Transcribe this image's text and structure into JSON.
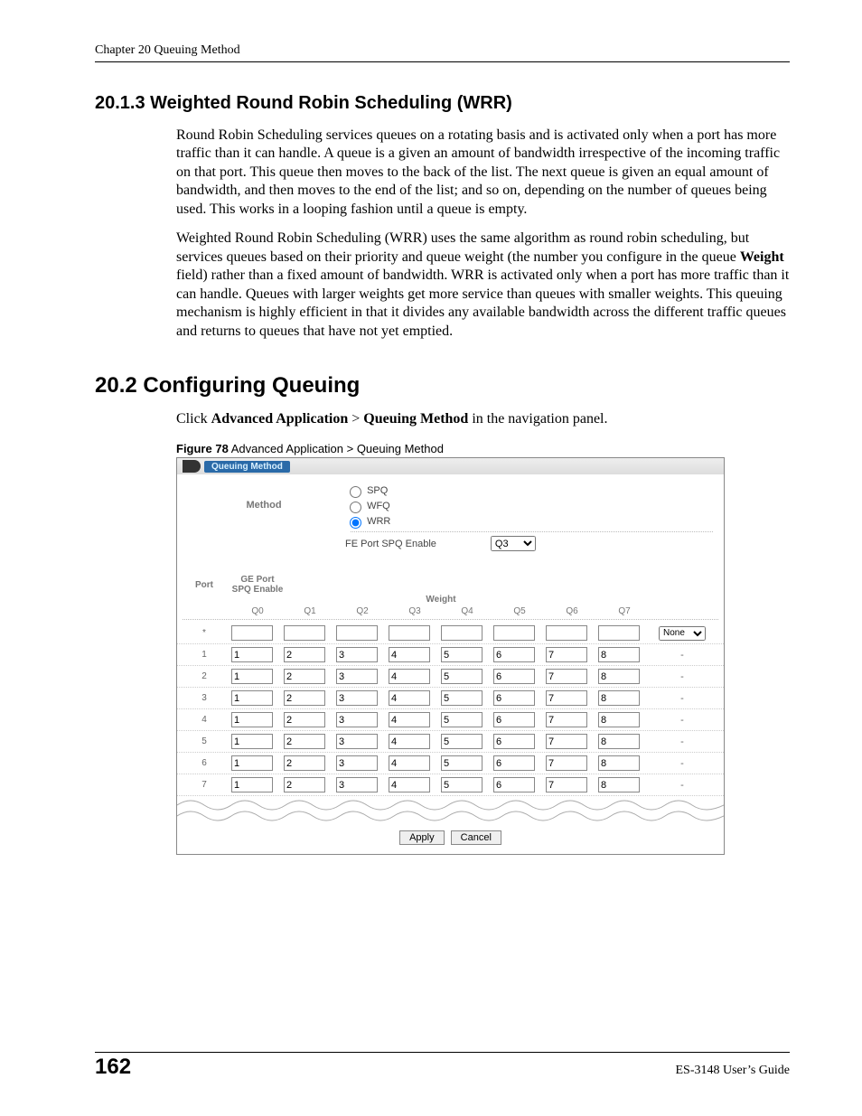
{
  "header": {
    "chapter": "Chapter 20 Queuing Method"
  },
  "section_2013": {
    "title": "20.1.3  Weighted Round Robin Scheduling (WRR)",
    "para1": "Round Robin Scheduling services queues on a rotating basis and is activated only when a port has more traffic than it can handle. A queue is a given an amount of bandwidth irrespective of the incoming traffic on that port. This queue then moves to the back of the list. The next queue is given an equal amount of bandwidth, and then moves to the end of the list; and so on, depending on the number of queues being used. This works in a looping fashion until a queue is empty.",
    "para2_a": "Weighted Round Robin Scheduling (WRR) uses the same algorithm as round robin scheduling, but services queues based on their priority and queue weight (the number you configure in the queue ",
    "para2_bold": "Weight",
    "para2_b": " field) rather than a fixed amount of bandwidth. WRR is activated only when a port has more traffic than it can handle. Queues with larger weights get more service than queues with smaller weights. This queuing mechanism is highly efficient in that it divides any available bandwidth across the different traffic queues and returns to queues that have not yet emptied."
  },
  "section_202": {
    "title": "20.2  Configuring Queuing",
    "click_a": "Click ",
    "click_b1": "Advanced Application",
    "click_sep": " > ",
    "click_b2": "Queuing Method",
    "click_c": " in the navigation panel."
  },
  "figure": {
    "label": "Figure 78",
    "caption": "   Advanced Application > Queuing Method",
    "tab": "Queuing Method",
    "method_label": "Method",
    "radios": {
      "spq": "SPQ",
      "wfq": "WFQ",
      "wrr": "WRR"
    },
    "selected_radio": "wrr",
    "fe_label": "FE Port SPQ Enable",
    "fe_value": "Q3",
    "columns": {
      "port": "Port",
      "weight": "Weight",
      "gep": "GE Port SPQ Enable"
    },
    "qcols": [
      "Q0",
      "Q1",
      "Q2",
      "Q3",
      "Q4",
      "Q5",
      "Q6",
      "Q7"
    ],
    "rows": [
      {
        "port": "*",
        "vals": [
          "",
          "",
          "",
          "",
          "",
          "",
          "",
          ""
        ],
        "gep": "None"
      },
      {
        "port": "1",
        "vals": [
          "1",
          "2",
          "3",
          "4",
          "5",
          "6",
          "7",
          "8"
        ],
        "gep": "-"
      },
      {
        "port": "2",
        "vals": [
          "1",
          "2",
          "3",
          "4",
          "5",
          "6",
          "7",
          "8"
        ],
        "gep": "-"
      },
      {
        "port": "3",
        "vals": [
          "1",
          "2",
          "3",
          "4",
          "5",
          "6",
          "7",
          "8"
        ],
        "gep": "-"
      },
      {
        "port": "4",
        "vals": [
          "1",
          "2",
          "3",
          "4",
          "5",
          "6",
          "7",
          "8"
        ],
        "gep": "-"
      },
      {
        "port": "5",
        "vals": [
          "1",
          "2",
          "3",
          "4",
          "5",
          "6",
          "7",
          "8"
        ],
        "gep": "-"
      },
      {
        "port": "6",
        "vals": [
          "1",
          "2",
          "3",
          "4",
          "5",
          "6",
          "7",
          "8"
        ],
        "gep": "-"
      },
      {
        "port": "7",
        "vals": [
          "1",
          "2",
          "3",
          "4",
          "5",
          "6",
          "7",
          "8"
        ],
        "gep": "-"
      }
    ],
    "apply": "Apply",
    "cancel": "Cancel"
  },
  "footer": {
    "page": "162",
    "guide": "ES-3148 User’s Guide"
  }
}
